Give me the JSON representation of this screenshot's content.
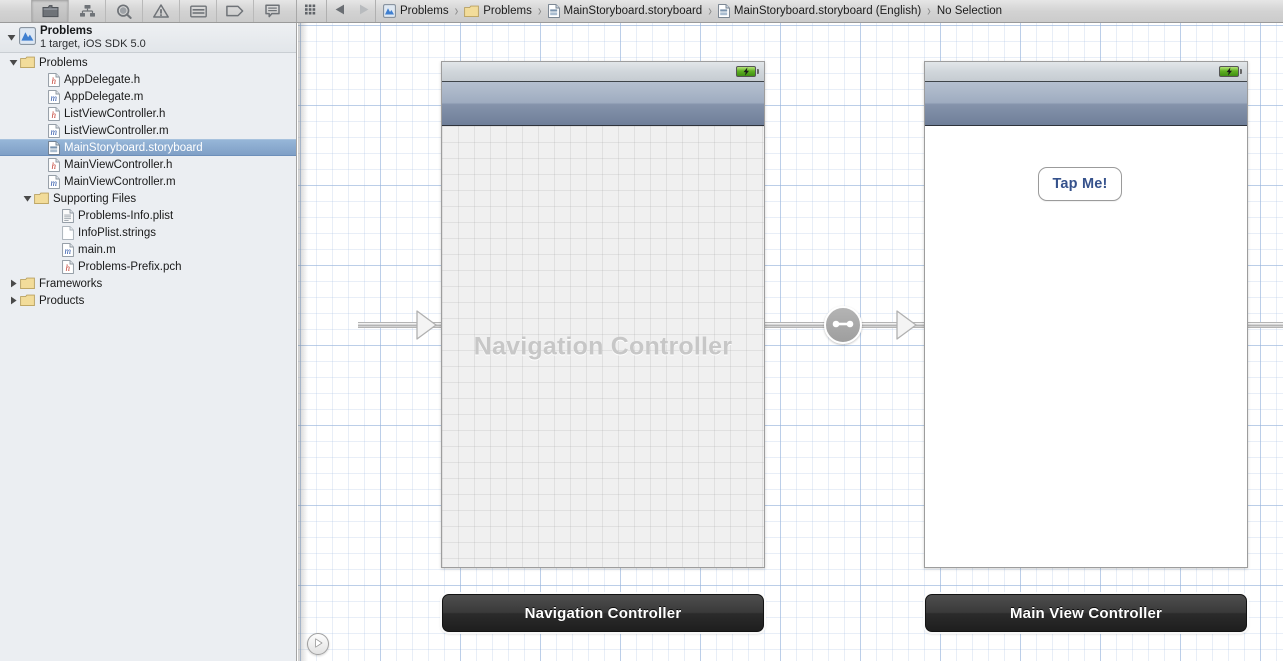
{
  "toolbar": {
    "buttons": [
      {
        "name": "folder-icon",
        "title": "Project navigator",
        "active": true
      },
      {
        "name": "hierarchy-icon",
        "title": "Symbol navigator",
        "active": false
      },
      {
        "name": "search-icon",
        "title": "Search navigator",
        "active": false
      },
      {
        "name": "warning-icon",
        "title": "Issue navigator",
        "active": false
      },
      {
        "name": "list-icon",
        "title": "Debug navigator",
        "active": false
      },
      {
        "name": "tag-icon",
        "title": "Breakpoint navigator",
        "active": false
      },
      {
        "name": "speech-icon",
        "title": "Log navigator",
        "active": false
      }
    ],
    "grid_button": "grid-icon",
    "back_button": "back-arrow-icon",
    "forward_button": "forward-arrow-icon"
  },
  "breadcrumb": {
    "separator": "›",
    "items": [
      {
        "label": "Problems",
        "icon": "xcode-project-icon"
      },
      {
        "label": "Problems",
        "icon": "folder-icon"
      },
      {
        "label": "MainStoryboard.storyboard",
        "icon": "storyboard-file-icon"
      },
      {
        "label": "MainStoryboard.storyboard (English)",
        "icon": "storyboard-file-icon"
      },
      {
        "label": "No Selection",
        "icon": "none"
      }
    ]
  },
  "navigator": {
    "project": {
      "name": "Problems",
      "subtitle": "1 target, iOS SDK 5.0",
      "icon": "xcode-project-icon",
      "expanded": true
    },
    "rows": [
      {
        "label": "Problems",
        "icon": "folder",
        "indent": 1,
        "twisty": "open",
        "selected": false
      },
      {
        "label": "AppDelegate.h",
        "icon": "h-file",
        "indent": 3,
        "twisty": "none",
        "selected": false
      },
      {
        "label": "AppDelegate.m",
        "icon": "m-file",
        "indent": 3,
        "twisty": "none",
        "selected": false
      },
      {
        "label": "ListViewController.h",
        "icon": "h-file",
        "indent": 3,
        "twisty": "none",
        "selected": false
      },
      {
        "label": "ListViewController.m",
        "icon": "m-file",
        "indent": 3,
        "twisty": "none",
        "selected": false
      },
      {
        "label": "MainStoryboard.storyboard",
        "icon": "storyboard",
        "indent": 3,
        "twisty": "none",
        "selected": true
      },
      {
        "label": "MainViewController.h",
        "icon": "h-file",
        "indent": 3,
        "twisty": "none",
        "selected": false
      },
      {
        "label": "MainViewController.m",
        "icon": "m-file",
        "indent": 3,
        "twisty": "none",
        "selected": false
      },
      {
        "label": "Supporting Files",
        "icon": "folder",
        "indent": 2,
        "twisty": "open",
        "selected": false
      },
      {
        "label": "Problems-Info.plist",
        "icon": "plist-file",
        "indent": 4,
        "twisty": "none",
        "selected": false
      },
      {
        "label": "InfoPlist.strings",
        "icon": "blank-file",
        "indent": 4,
        "twisty": "none",
        "selected": false
      },
      {
        "label": "main.m",
        "icon": "m-file",
        "indent": 4,
        "twisty": "none",
        "selected": false
      },
      {
        "label": "Problems-Prefix.pch",
        "icon": "h-file",
        "indent": 4,
        "twisty": "none",
        "selected": false
      },
      {
        "label": "Frameworks",
        "icon": "folder",
        "indent": 1,
        "twisty": "closed",
        "selected": false
      },
      {
        "label": "Products",
        "icon": "folder",
        "indent": 1,
        "twisty": "closed",
        "selected": false
      }
    ]
  },
  "canvas": {
    "scenes": [
      {
        "id": "navigation-controller",
        "title": "Navigation Controller",
        "placeholder": "Navigation Controller",
        "has_navbar": true,
        "has_statusbar": true,
        "battery_icon": "battery-charging-icon"
      },
      {
        "id": "main-view-controller",
        "title": "Main View Controller",
        "has_navbar": true,
        "has_statusbar": true,
        "battery_icon": "battery-charging-icon",
        "button_label": "Tap Me!"
      }
    ],
    "segue_badge_icon": "relationship-segue-icon",
    "entry_arrow_icon": "initial-viewcontroller-arrow",
    "zoom_control_icon": "play-triangle-icon"
  },
  "colors": {
    "selection_blue_top": "#96b6d8",
    "selection_blue_bottom": "#7f9fc6",
    "grid_line": "#96b4dc",
    "button_text_blue": "#36528c",
    "navbar_top": "#b5c0d0",
    "navbar_bottom": "#6f7f99",
    "scene_bar_dark": "#2b2b2b",
    "placeholder_gray": "#c7c7c7",
    "battery_green": "#5fb022"
  }
}
